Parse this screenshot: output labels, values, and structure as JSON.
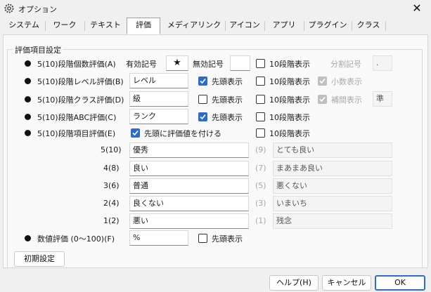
{
  "window": {
    "title": "オプション",
    "close_glyph": "✕"
  },
  "tabs": [
    "システム",
    "ワーク",
    "テキスト",
    "評価",
    "メディアリンク",
    "アイコン",
    "アプリ",
    "プラグイン",
    "クラス"
  ],
  "group": {
    "title": "評価項目設定"
  },
  "rows": {
    "count_eval": {
      "label": "5(10)段階個数評価(A)",
      "valid_label": "有効記号",
      "valid_value": "★",
      "invalid_label": "無効記号",
      "invalid_value": "",
      "ten_label": "10段階表示",
      "split_label": "分割記号",
      "split_value": "."
    },
    "level_eval": {
      "label": "5(10)段階レベル評価(B)",
      "value": "レベル",
      "head_label": "先頭表示",
      "ten_label": "10段階表示",
      "decimal_label": "小数表示"
    },
    "class_eval": {
      "label": "5(10)段階クラス評価(D)",
      "value": "級",
      "head_label": "先頭表示",
      "ten_label": "10段階表示",
      "interp_label": "補間表示",
      "interp_value": "準"
    },
    "abc_eval": {
      "label": "5(10)段階ABC評価(C)",
      "value": "ランク",
      "head_label": "先頭表示",
      "ten_label": "10段階表示"
    },
    "item_eval": {
      "label": "5(10)段階項目評価(E)",
      "prefix_label": "先頭に評価値を付ける",
      "ten_label": "10段階表示"
    }
  },
  "levels": [
    {
      "key": "5(10)",
      "value": "優秀",
      "alt_key": "(9)",
      "alt_value": "とても良い"
    },
    {
      "key": "4(8)",
      "value": "良い",
      "alt_key": "(7)",
      "alt_value": "まあまあ良い"
    },
    {
      "key": "3(6)",
      "value": "普通",
      "alt_key": "(5)",
      "alt_value": "悪くない"
    },
    {
      "key": "2(4)",
      "value": "良くない",
      "alt_key": "(3)",
      "alt_value": "いまいち"
    },
    {
      "key": "1(2)",
      "value": "悪い",
      "alt_key": "(1)",
      "alt_value": "残念"
    }
  ],
  "numeric": {
    "label": "数値評価 (0〜100)(F)",
    "value": "%",
    "head_label": "先頭表示"
  },
  "buttons": {
    "reset": "初期設定",
    "help": "ヘルプ(H)",
    "cancel": "キャンセル",
    "ok": "OK"
  },
  "checkbox_states": {
    "count_ten": false,
    "level_head": true,
    "level_ten": false,
    "level_decimal": true,
    "class_head": false,
    "class_ten": false,
    "class_interp": true,
    "abc_head": true,
    "abc_ten": false,
    "item_prefix": true,
    "item_ten": false,
    "numeric_head": false
  },
  "colors": {
    "accent": "#2f6cc7",
    "disabled_check": "#bfbfbf"
  }
}
